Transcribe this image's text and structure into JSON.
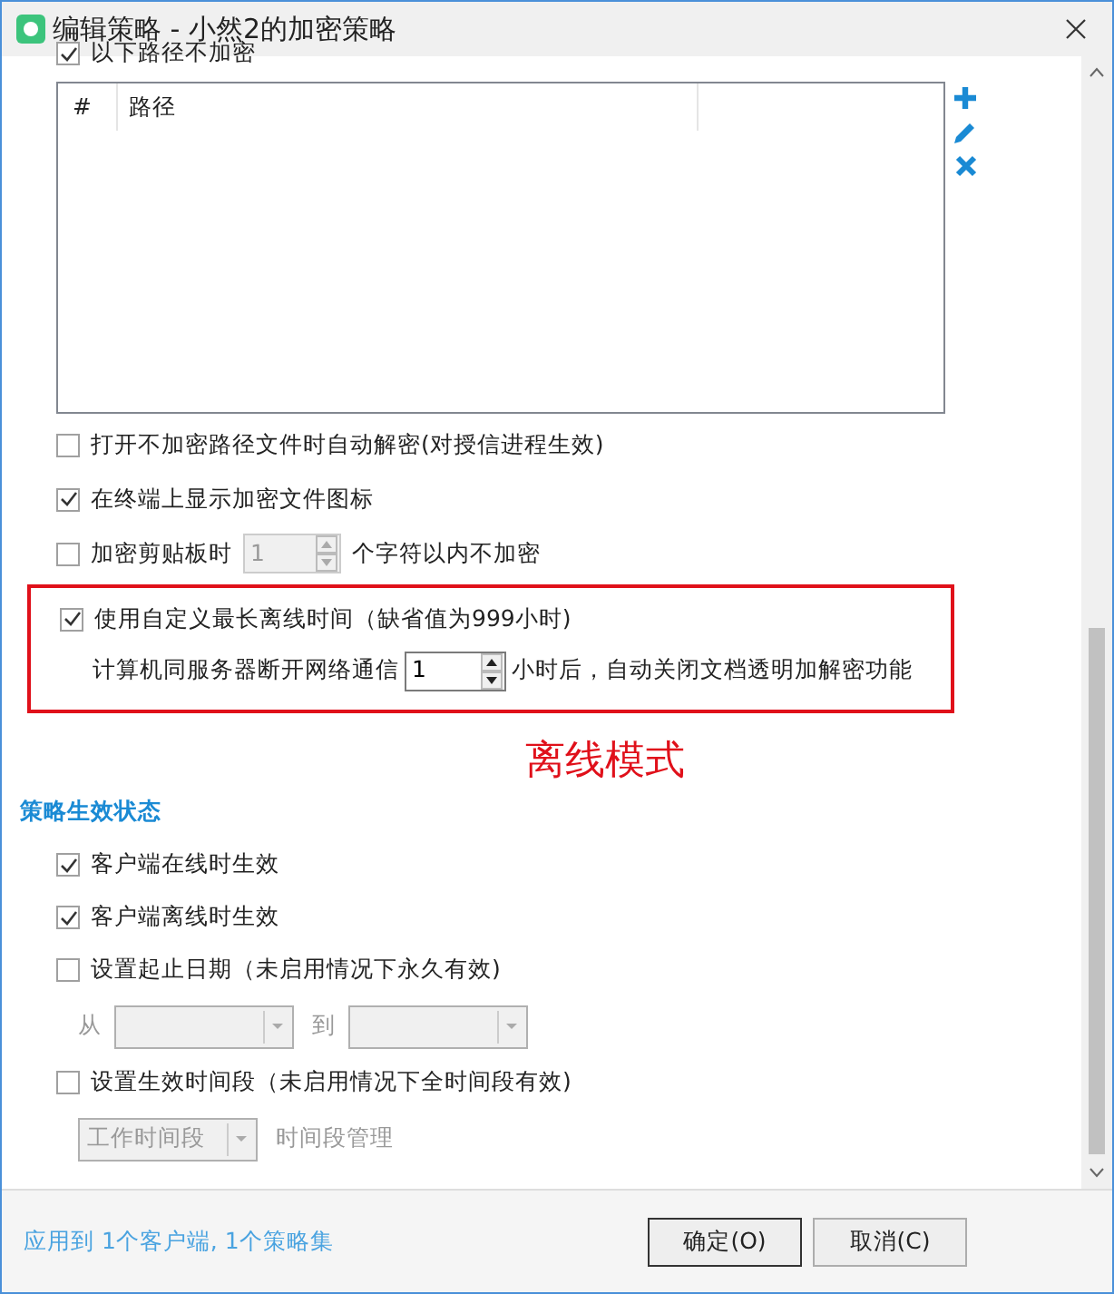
{
  "window": {
    "title": "编辑策略 - 小然2的加密策略"
  },
  "exclude_paths": {
    "label": "以下路径不加密",
    "checked": true,
    "columns": [
      "#",
      "路径"
    ]
  },
  "options": [
    {
      "kind": "check",
      "label": "打开不加密路径文件时自动解密(对授信进程生效)",
      "checked": false
    },
    {
      "kind": "check",
      "label": "在终端上显示加密文件图标",
      "checked": true
    },
    {
      "kind": "spin",
      "label": "加密剪贴板时",
      "value": "1",
      "suffix": "个字符以内不加密",
      "checked": false
    }
  ],
  "offline": {
    "label": "使用自定义最长离线时间（缺省值为999小时)",
    "checked": true,
    "prefix": "计算机同服务器断开网络通信",
    "value": "1",
    "suffix": "小时后，自动关闭文档透明加解密功能",
    "annotation": "离线模式"
  },
  "status_section": {
    "title": "策略生效状态",
    "items": [
      {
        "kind": "check",
        "label": "客户端在线时生效",
        "checked": true
      },
      {
        "kind": "check",
        "label": "客户端离线时生效",
        "checked": true
      },
      {
        "kind": "check",
        "label": "设置起止日期（未启用情况下永久有效)",
        "checked": false
      },
      {
        "kind": "range",
        "from": "从",
        "to": "到"
      },
      {
        "kind": "check",
        "label": "设置生效时间段（未启用情况下全时间段有效)",
        "checked": false
      },
      {
        "kind": "select",
        "value": "工作时间段",
        "link": "时间段管理"
      }
    ]
  },
  "footer": {
    "summary": "应用到 1个客户端, 1个策略集",
    "buttons": [
      "确定(O)",
      "取消(C)"
    ]
  }
}
